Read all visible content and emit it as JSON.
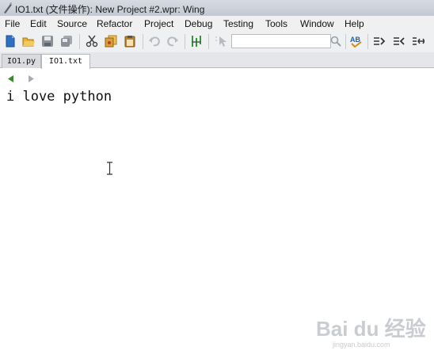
{
  "window": {
    "title": "IO1.txt (文件操作): New Project #2.wpr: Wing"
  },
  "menu": [
    "File",
    "Edit",
    "Source",
    "Refactor",
    "Project",
    "Debug",
    "Testing",
    "Tools",
    "Window",
    "Help"
  ],
  "toolbar": {
    "search_value": ""
  },
  "tabs": [
    {
      "label": "IO1.py"
    },
    {
      "label": "IO1.txt"
    }
  ],
  "editor": {
    "lines": [
      "i love python"
    ]
  },
  "watermark": {
    "brand": "Bai du 经验",
    "url": "jingyan.baidu.com"
  },
  "colors": {
    "nav_active": "#3a8a2c",
    "nav_inactive": "#a8adb3"
  }
}
